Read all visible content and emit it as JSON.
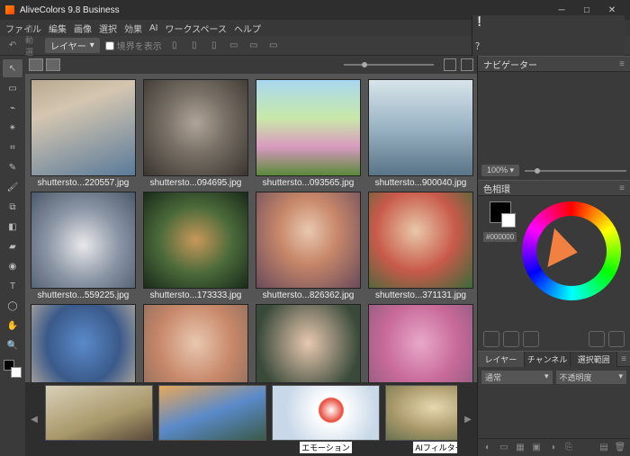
{
  "titlebar": {
    "title": "AliveColors 9.8 Business"
  },
  "menu": [
    "ファイル",
    "編集",
    "画像",
    "選択",
    "効果",
    "AI",
    "ワークスペース",
    "ヘルプ"
  ],
  "optbar": {
    "layer_dd": "レイヤー",
    "bounds_chk": "境界を表示"
  },
  "thumbs": [
    {
      "label": "shuttersto...220557.jpg",
      "cls": "p0"
    },
    {
      "label": "shuttersto...094695.jpg",
      "cls": "p1"
    },
    {
      "label": "shuttersto...093565.jpg",
      "cls": "p2"
    },
    {
      "label": "shuttersto...900040.jpg",
      "cls": "p3"
    },
    {
      "label": "shuttersto...559225.jpg",
      "cls": "p4"
    },
    {
      "label": "shuttersto...173333.jpg",
      "cls": "p5"
    },
    {
      "label": "shuttersto...826362.jpg",
      "cls": "p6"
    },
    {
      "label": "shuttersto...371131.jpg",
      "cls": "p7"
    },
    {
      "label": "",
      "cls": "p8"
    },
    {
      "label": "",
      "cls": "p9"
    },
    {
      "label": "",
      "cls": "p10"
    },
    {
      "label": "",
      "cls": "p11"
    }
  ],
  "filmstrip": [
    {
      "label": "",
      "cls": "pf0"
    },
    {
      "label": "",
      "cls": "pf1"
    },
    {
      "label": "エモーション",
      "cls": "pf2"
    },
    {
      "label": "AIフィルター",
      "cls": "pf3"
    }
  ],
  "panels": {
    "navigator": {
      "title": "ナビゲーター",
      "zoom": "100%"
    },
    "color": {
      "title": "色相環",
      "hex": "#000000"
    },
    "layers": {
      "tabs": [
        "レイヤー",
        "チャンネル",
        "選択範囲"
      ],
      "blend": "通常",
      "opacity": "不透明度"
    }
  }
}
